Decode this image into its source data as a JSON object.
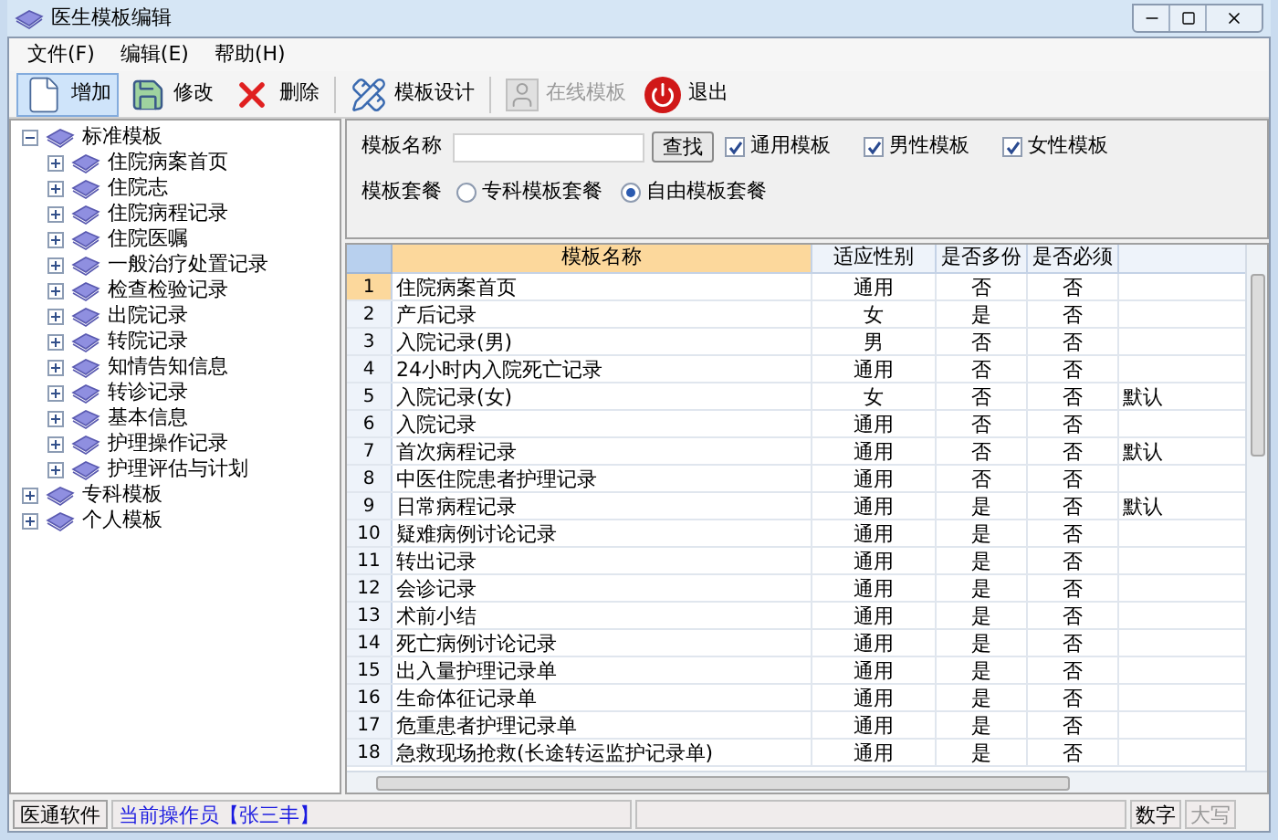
{
  "window": {
    "title": "医生模板编辑"
  },
  "menu": [
    "文件(F)",
    "编辑(E)",
    "帮助(H)"
  ],
  "toolbar": [
    {
      "label": "增加",
      "kind": "add",
      "selected": true,
      "disabled": false
    },
    {
      "label": "修改",
      "kind": "edit",
      "selected": false,
      "disabled": false
    },
    {
      "label": "删除",
      "kind": "delete",
      "selected": false,
      "disabled": false
    },
    {
      "label": "模板设计",
      "kind": "design",
      "selected": false,
      "disabled": false
    },
    {
      "label": "在线模板",
      "kind": "online",
      "selected": false,
      "disabled": true
    },
    {
      "label": "退出",
      "kind": "exit",
      "selected": false,
      "disabled": false
    }
  ],
  "tree": [
    {
      "label": "标准模板",
      "expanded": true,
      "children": [
        {
          "label": "住院病案首页",
          "expanded": false
        },
        {
          "label": "住院志",
          "expanded": false
        },
        {
          "label": "住院病程记录",
          "expanded": false
        },
        {
          "label": "住院医嘱",
          "expanded": false
        },
        {
          "label": "一般治疗处置记录",
          "expanded": false
        },
        {
          "label": "检查检验记录",
          "expanded": false
        },
        {
          "label": "出院记录",
          "expanded": false
        },
        {
          "label": "转院记录",
          "expanded": false
        },
        {
          "label": "知情告知信息",
          "expanded": false
        },
        {
          "label": "转诊记录",
          "expanded": false
        },
        {
          "label": "基本信息",
          "expanded": false
        },
        {
          "label": "护理操作记录",
          "expanded": false
        },
        {
          "label": "护理评估与计划",
          "expanded": false
        }
      ]
    },
    {
      "label": "专科模板",
      "expanded": false
    },
    {
      "label": "个人模板",
      "expanded": false
    }
  ],
  "filter": {
    "name_label": "模板名称",
    "search_button": "查找",
    "checkboxes": [
      {
        "label": "通用模板",
        "checked": true
      },
      {
        "label": "男性模板",
        "checked": true
      },
      {
        "label": "女性模板",
        "checked": true
      }
    ],
    "package_label": "模板套餐",
    "radios": [
      {
        "label": "专科模板套餐",
        "selected": false
      },
      {
        "label": "自由模板套餐",
        "selected": true
      }
    ]
  },
  "table": {
    "columns": [
      {
        "label": "模板名称",
        "selected": true
      },
      {
        "label": "适应性别",
        "selected": false
      },
      {
        "label": "是否多份",
        "selected": false
      },
      {
        "label": "是否必须",
        "selected": false
      }
    ],
    "rows": [
      {
        "number": "1",
        "name": "住院病案首页",
        "gender": "通用",
        "multiple": "否",
        "required": "否",
        "selected": true
      },
      {
        "number": "2",
        "name": "产后记录",
        "gender": "女",
        "multiple": "是",
        "required": "否",
        "selected": false
      },
      {
        "number": "3",
        "name": "入院记录(男)",
        "gender": "男",
        "multiple": "否",
        "required": "否",
        "selected": false
      },
      {
        "number": "4",
        "name": "24小时内入院死亡记录",
        "gender": "通用",
        "multiple": "否",
        "required": "否",
        "selected": false
      },
      {
        "number": "5",
        "name": "入院记录(女)",
        "gender": "女",
        "multiple": "否",
        "required": "否",
        "note": "默认",
        "selected": false
      },
      {
        "number": "6",
        "name": "入院记录",
        "gender": "通用",
        "multiple": "否",
        "required": "否",
        "selected": false
      },
      {
        "number": "7",
        "name": "首次病程记录",
        "gender": "通用",
        "multiple": "否",
        "required": "否",
        "note": "默认",
        "selected": false
      },
      {
        "number": "8",
        "name": "中医住院患者护理记录",
        "gender": "通用",
        "multiple": "否",
        "required": "否",
        "selected": false
      },
      {
        "number": "9",
        "name": "日常病程记录",
        "gender": "通用",
        "multiple": "是",
        "required": "否",
        "note": "默认",
        "selected": false
      },
      {
        "number": "10",
        "name": "疑难病例讨论记录",
        "gender": "通用",
        "multiple": "是",
        "required": "否",
        "selected": false
      },
      {
        "number": "11",
        "name": "转出记录",
        "gender": "通用",
        "multiple": "是",
        "required": "否",
        "selected": false
      },
      {
        "number": "12",
        "name": "会诊记录",
        "gender": "通用",
        "multiple": "是",
        "required": "否",
        "selected": false
      },
      {
        "number": "13",
        "name": "术前小结",
        "gender": "通用",
        "multiple": "是",
        "required": "否",
        "selected": false
      },
      {
        "number": "14",
        "name": "死亡病例讨论记录",
        "gender": "通用",
        "multiple": "是",
        "required": "否",
        "selected": false
      },
      {
        "number": "15",
        "name": "出入量护理记录单",
        "gender": "通用",
        "multiple": "是",
        "required": "否",
        "selected": false
      },
      {
        "number": "16",
        "name": "生命体征记录单",
        "gender": "通用",
        "multiple": "是",
        "required": "否",
        "selected": false
      },
      {
        "number": "17",
        "name": "危重患者护理记录单",
        "gender": "通用",
        "multiple": "是",
        "required": "否",
        "selected": false
      },
      {
        "number": "18",
        "name": "急救现场抢救(长途转运监护记录单)",
        "gender": "通用",
        "multiple": "是",
        "required": "否",
        "selected": false
      }
    ]
  },
  "status_bar": {
    "company": "医通软件",
    "operator": "当前操作员【张三丰】",
    "num_lock": {
      "label": "数字",
      "on": true
    },
    "caps_lock": {
      "label": "大写",
      "on": false
    }
  }
}
